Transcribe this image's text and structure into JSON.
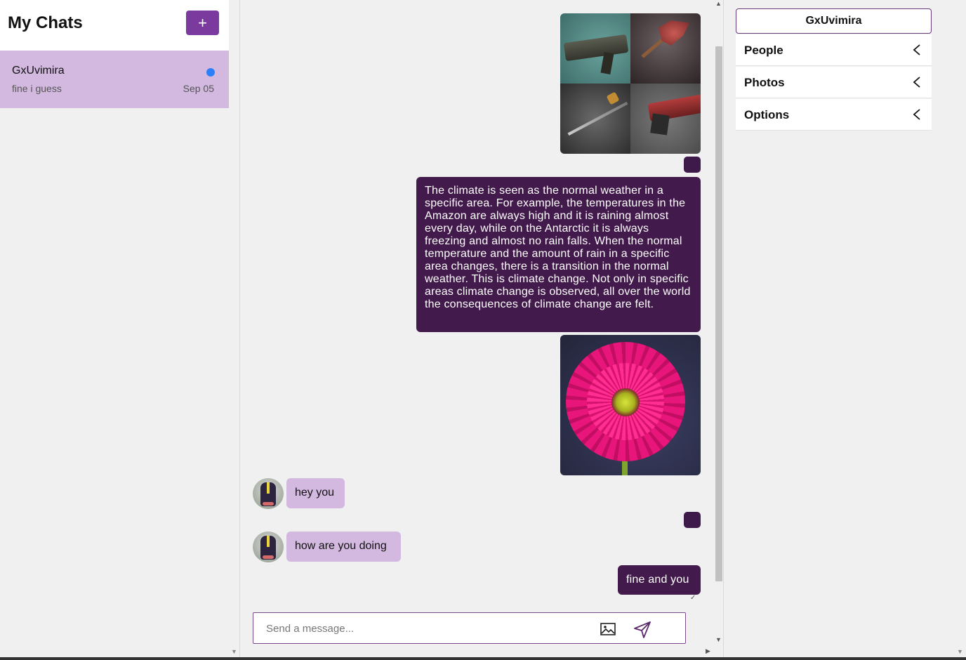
{
  "sidebar": {
    "title": "My Chats",
    "new_chat_label": "+",
    "chats": [
      {
        "name": "GxUvimira",
        "preview": "fine i guess",
        "date": "Sep 05",
        "unread": true
      }
    ]
  },
  "conversation": {
    "messages": [
      {
        "type": "image",
        "direction": "outgoing",
        "content": "weapons collage"
      },
      {
        "type": "text",
        "direction": "outgoing",
        "text": "The climate is seen as the normal weather in a specific area. For example, the temperatures in the Amazon are always high and it is raining almost every day, while on the Antarctic it is always freezing and almost no rain falls. When the normal temperature and the amount of rain in a specific area changes, there is a transition in the normal weather. This is climate change. Not only in specific areas climate change is observed, all over the world the consequences of climate change are felt."
      },
      {
        "type": "image",
        "direction": "outgoing",
        "content": "pink gerbera flower"
      },
      {
        "type": "text",
        "direction": "incoming",
        "text": "hey you"
      },
      {
        "type": "text",
        "direction": "incoming",
        "text": "how are you doing"
      },
      {
        "type": "text",
        "direction": "outgoing",
        "text": "fine and you"
      }
    ],
    "composer": {
      "placeholder": "Send a message...",
      "value": ""
    }
  },
  "details": {
    "contact_name": "GxUvimira",
    "sections": [
      {
        "label": "People"
      },
      {
        "label": "Photos"
      },
      {
        "label": "Options"
      }
    ]
  },
  "colors": {
    "accent": "#7b3a9e",
    "outgoing_bubble": "#421a4b",
    "incoming_bubble": "#d3b8e0",
    "unread_dot": "#2d7ff9"
  }
}
